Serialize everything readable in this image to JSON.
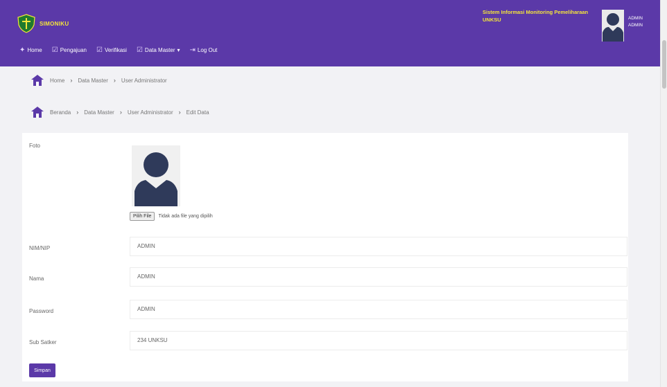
{
  "app": {
    "name": "SIMONIKU"
  },
  "nav": [
    {
      "icon": "home-icon",
      "label": "Home"
    },
    {
      "icon": "check-icon",
      "label": "Pengajuan"
    },
    {
      "icon": "check-icon",
      "label": "Verifikasi"
    },
    {
      "icon": "check-icon",
      "label": "Data Master"
    },
    {
      "icon": "logout-icon",
      "label": "Log Out"
    }
  ],
  "nav_caret": "▾",
  "header": {
    "system_title_line1": "Sistem Informasi Monitoring Pemeliharaan",
    "system_title_line2": "UNKSU",
    "user_name": "ADMIN",
    "user_role": "ADMIN"
  },
  "breadcrumb_1": [
    "Home",
    "Data Master",
    "User Administrator"
  ],
  "breadcrumb_2": [
    "Beranda",
    "Data Master",
    "User Administrator",
    "Edit Data"
  ],
  "breadcrumb_sep": "›",
  "form": {
    "foto_label": "Foto",
    "file_button": "Pilih File",
    "file_status": "Tidak ada file yang dipilih",
    "fields": [
      {
        "label": "NIM/NIP",
        "value": "ADMIN"
      },
      {
        "label": "Nama",
        "value": "ADMIN"
      },
      {
        "label": "Password",
        "value": "ADMIN"
      },
      {
        "label": "Sub Satker",
        "value": "234 UNKSU"
      }
    ],
    "submit_label": "Simpan"
  },
  "colors": {
    "primary": "#5b39a8",
    "accent_yellow": "#f4e53a",
    "avatar": "#2f3a5a"
  }
}
